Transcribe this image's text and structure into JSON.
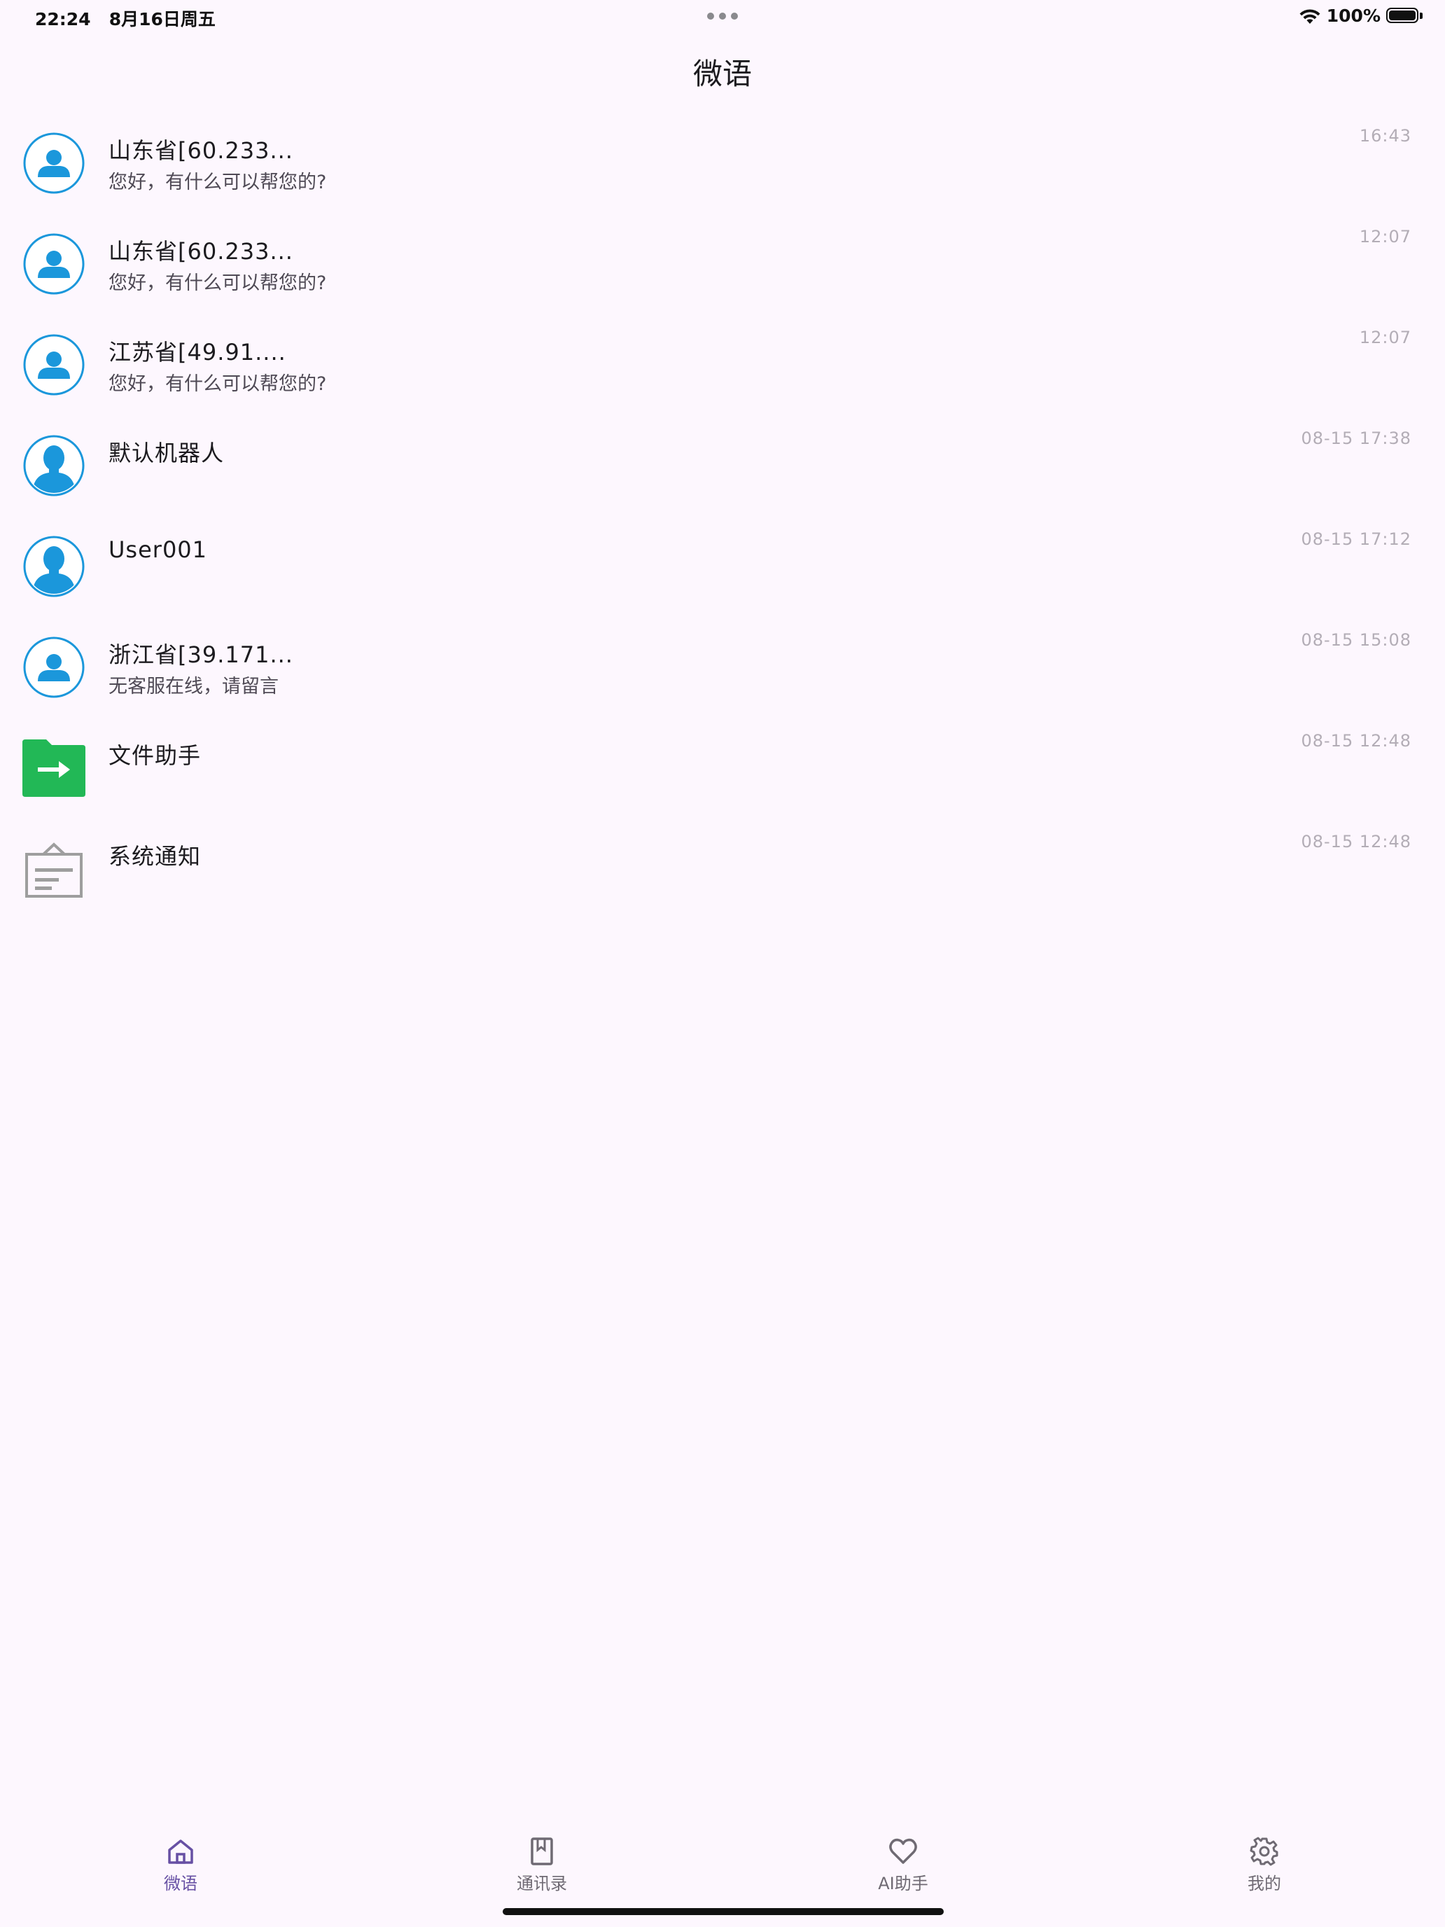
{
  "status_bar": {
    "time": "22:24",
    "date": "8月16日周五",
    "battery": "100%"
  },
  "header": {
    "title": "微语"
  },
  "conversations": [
    {
      "name": "山东省[60.233...",
      "preview": "您好，有什么可以帮您的?",
      "time": "16:43",
      "avatar": "user-outline-icon"
    },
    {
      "name": "山东省[60.233...",
      "preview": "您好，有什么可以帮您的?",
      "time": "12:07",
      "avatar": "user-outline-icon"
    },
    {
      "name": "江苏省[49.91....",
      "preview": "您好，有什么可以帮您的?",
      "time": "12:07",
      "avatar": "user-outline-icon"
    },
    {
      "name": "默认机器人",
      "preview": "",
      "time": "08-15 17:38",
      "avatar": "user-filled-icon"
    },
    {
      "name": "User001",
      "preview": "",
      "time": "08-15 17:12",
      "avatar": "user-filled-icon"
    },
    {
      "name": "浙江省[39.171...",
      "preview": "无客服在线，请留言",
      "time": "08-15 15:08",
      "avatar": "user-outline-icon"
    },
    {
      "name": "文件助手",
      "preview": "",
      "time": "08-15 12:48",
      "avatar": "file-transfer-icon"
    },
    {
      "name": "系统通知",
      "preview": "",
      "time": "08-15 12:48",
      "avatar": "notice-icon"
    }
  ],
  "bottom_nav": {
    "items": [
      {
        "label": "微语",
        "icon": "home-icon",
        "active": true
      },
      {
        "label": "通讯录",
        "icon": "contacts-book-icon",
        "active": false
      },
      {
        "label": "AI助手",
        "icon": "heart-icon",
        "active": false
      },
      {
        "label": "我的",
        "icon": "gear-icon",
        "active": false
      }
    ]
  },
  "colors": {
    "background": "#FDF7FE",
    "accent": "#6750A4",
    "avatar_blue": "#1B97DB",
    "file_green": "#22B856",
    "notice_gray": "#9E9E9E",
    "time_gray": "#B3ADB6"
  }
}
